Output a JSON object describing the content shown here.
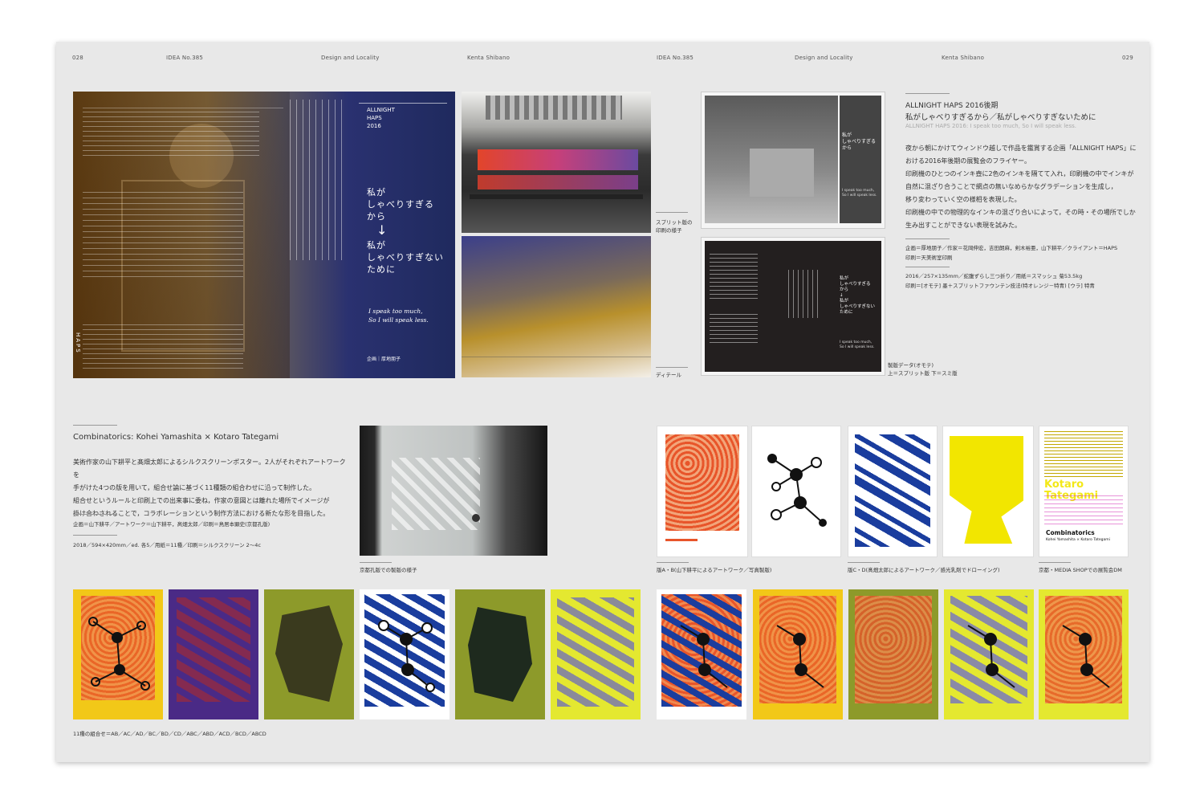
{
  "header": {
    "page_left": "028",
    "issue_left": "IDEA No.385",
    "section_left": "Design and Locality",
    "author_left": "Kenta Shibano",
    "issue_right": "IDEA No.385",
    "section_right": "Design and Locality",
    "author_right": "Kenta Shibano",
    "page_right": "029"
  },
  "haps": {
    "flyer_label": "ALLNIGHT\nHAPS\n2016",
    "flyer_title1": "私が\nしゃべりすぎる\nから",
    "flyer_arrow": "↓",
    "flyer_title2": "私が\nしゃべりすぎない\nために",
    "flyer_english": "I speak too much,\nSo I will speak less.",
    "flyer_credit": "企画｜厚地朋子",
    "flyer_logo": "HAPS",
    "cap_press": "スプリット版の\n印刷の様子",
    "cap_detail": "ディテール",
    "cap_data": "製版データ(オモテ)\n上＝スプリット版 下＝スミ版",
    "title_en": "ALLNIGHT HAPS 2016後期",
    "title_ja": "私がしゃべりすぎるから／私がしゃべりすぎないために",
    "title_sub": "ALLNIGHT HAPS 2016: I speak too much, So I will speak less.",
    "body": [
      "夜から朝にかけてウィンドウ越しで作品を鑑賞する企画「ALLNIGHT HAPS」に",
      "おける2016年後期の展覧会のフライヤー。",
      "印刷機のひとつのインキ壺に2色のインキを隔てて入れ，印刷機の中でインキが",
      "自然に混ざり合うことで網点の無いなめらかなグラデーションを生成し，",
      "移り変わっていく空の様相を表現した。",
      "印刷機の中での物理的なインキの混ざり合いによって，その時・その場所でしか",
      "生み出すことができない表現を試みた。"
    ],
    "credits1": "企画＝厚地朋子／作家＝花岡伸宏，吉田朗麻，剣木裕亜，山下耕平／クライアント＝HAPS",
    "credits2": "印刷＝天美術室印刷",
    "spec1": "2016／257×135mm／蛇腹ずらし三つ折り／用紙＝スマッシュ 菊53.5kg",
    "spec2": "印刷＝[オモテ] 墨＋スプリットファウンテン技法(特オレンジ－特青) [ウラ] 特青",
    "mini1_title": "私が\nしゃべりすぎる\nから",
    "mini2_title": "私が\nしゃべりすぎる\nから\n↓\n私が\nしゃべりすぎない\nために",
    "mini_english": "I speak too much,\nSo I will speak less."
  },
  "combi": {
    "title": "Combinatorics: Kohei Yamashita × Kotaro Tategami",
    "body": [
      "美術作家の山下耕平と髙畑太郎によるシルクスクリーンポスター。2人がそれぞれアートワークを",
      "手がけた4つの版を用いて，組合せ論に基づく11種類の組合わせに沿って制作した。",
      "組合せというルールと印刷上での出来事に委ね，作家の意図とは離れた場所でイメージが",
      "掛け合わされることで，コラボレーションという制作方法における新たな形を目指した。"
    ],
    "credits": "企画＝山下耕平／アートワーク＝山下耕平，髙畑太郎／印刷＝鳥居本顕史(京都孔版)",
    "spec": "2018／594×420mm／ed. 各5／用紙＝11種／印刷＝シルクスクリーン 2〜4c",
    "cap_studio": "京都孔版での製版の様子",
    "cap_ab": "版A・B(山下耕平によるアートワーク／写真製版)",
    "cap_cd": "版C・D(髙畑太郎によるアートワーク／感光乳剤でドローイング)",
    "cap_dm": "京都・MEDIA SHOPでの展覧会DM",
    "dm_title": "Combinatorics",
    "dm_names": "Kohei Yamashita × Kotaro Tategami",
    "dm_big": "Kotaro Tategami",
    "cap_combos": "11種の組合せ＝AB／AC／AD／BC／BD／CD／ABC／ABD／ACD／BCD／ABCD"
  },
  "colors": {
    "spread_bg": "#e8e8e8",
    "navy": "#1f2a5e",
    "orange": "#e8552a",
    "yellow": "#f2e600",
    "blue": "#1a3d9e",
    "olive": "#8d9a2a",
    "purple": "#4a2a86"
  }
}
